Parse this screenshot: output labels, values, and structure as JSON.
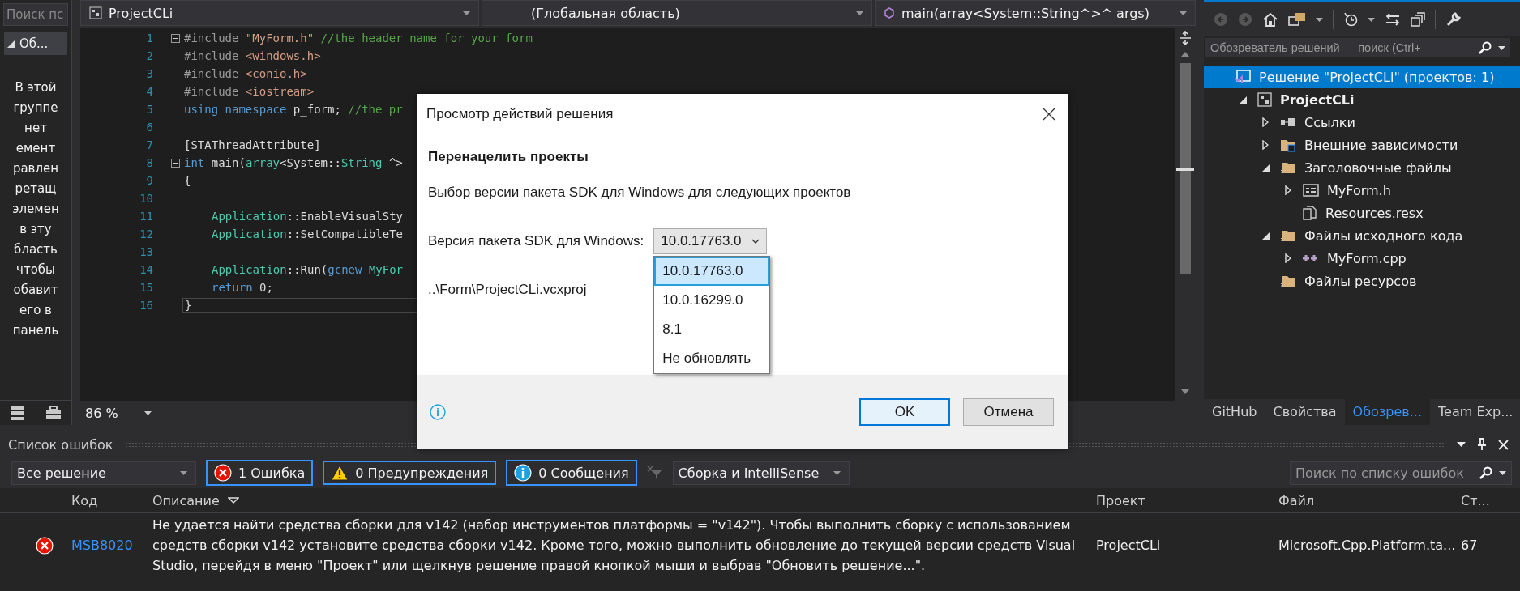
{
  "toolbox": {
    "search": {
      "placeholder": "Поиск пс"
    },
    "group": {
      "label": "Об...",
      "expanded": true
    },
    "message_lines": [
      "В этой",
      "группе",
      "нет",
      "емент",
      "равлен",
      "ретащ",
      "элемен",
      "в эту",
      "бласть",
      "чтобы",
      "обавит",
      "его в",
      "панель"
    ]
  },
  "editor": {
    "nav": [
      {
        "kind": "project",
        "label": "ProjectCLi"
      },
      {
        "kind": "scope",
        "label": "(Глобальная область)"
      },
      {
        "kind": "member",
        "label": "main(array<System::String^>^ args)"
      }
    ],
    "lines": [
      {
        "number": "1",
        "foldable": true,
        "tokens": [
          {
            "t": "#include ",
            "kind": "pre"
          },
          {
            "t": "\"MyForm.h\" ",
            "kind": "str"
          },
          {
            "t": "//the header name for your form",
            "kind": "comment"
          }
        ]
      },
      {
        "number": "2",
        "tokens": [
          {
            "t": "#include ",
            "kind": "pre"
          },
          {
            "t": "<windows.h>",
            "kind": "str"
          }
        ]
      },
      {
        "number": "3",
        "tokens": [
          {
            "t": "#include ",
            "kind": "pre"
          },
          {
            "t": "<conio.h>",
            "kind": "str"
          }
        ]
      },
      {
        "number": "4",
        "tokens": [
          {
            "t": "#include ",
            "kind": "pre"
          },
          {
            "t": "<iostream>",
            "kind": "str"
          }
        ]
      },
      {
        "number": "5",
        "tokens": [
          {
            "t": "using namespace ",
            "kind": "kw"
          },
          {
            "t": "p_form; ",
            "kind": "plain"
          },
          {
            "t": "//the pr",
            "kind": "comment"
          }
        ]
      },
      {
        "number": "6"
      },
      {
        "number": "7",
        "tokens": [
          {
            "t": "[STAThreadAttribute]",
            "kind": "plain"
          }
        ]
      },
      {
        "number": "8",
        "foldable": true,
        "tokens": [
          {
            "t": "int ",
            "kind": "kw"
          },
          {
            "t": "main(",
            "kind": "plain"
          },
          {
            "t": "array",
            "kind": "type"
          },
          {
            "t": "<System::",
            "kind": "plain"
          },
          {
            "t": "String",
            "kind": "type"
          },
          {
            "t": " ^>",
            "kind": "plain"
          }
        ]
      },
      {
        "number": "9",
        "tokens": [
          {
            "t": "{",
            "kind": "plain"
          }
        ]
      },
      {
        "number": "10"
      },
      {
        "number": "11",
        "indented": true,
        "tokens": [
          {
            "t": "Application",
            "kind": "type"
          },
          {
            "t": "::EnableVisualSty",
            "kind": "plain"
          }
        ]
      },
      {
        "number": "12",
        "indented": true,
        "tokens": [
          {
            "t": "Application",
            "kind": "type"
          },
          {
            "t": "::SetCompatibleTe",
            "kind": "plain"
          }
        ]
      },
      {
        "number": "13"
      },
      {
        "number": "14",
        "indented": true,
        "tokens": [
          {
            "t": "Application",
            "kind": "type"
          },
          {
            "t": "::Run(",
            "kind": "plain"
          },
          {
            "t": "gcnew ",
            "kind": "kw"
          },
          {
            "t": "MyFor",
            "kind": "type"
          }
        ]
      },
      {
        "number": "15",
        "indented": true,
        "tokens": [
          {
            "t": "return ",
            "kind": "kw"
          },
          {
            "t": "0;",
            "kind": "plain"
          }
        ]
      },
      {
        "number": "16",
        "current": true,
        "tokens": [
          {
            "t": "}",
            "kind": "plain"
          }
        ]
      }
    ],
    "zoom": "86 %"
  },
  "dialog": {
    "title": "Просмотр действий решения",
    "heading": "Перенацелить проекты",
    "description": "Выбор версии пакета SDK для Windows для следующих проектов",
    "sdk_label": "Версия пакета SDK для Windows:",
    "sdk_value": "10.0.17763.0",
    "sdk_options": [
      {
        "label": "10.0.17763.0",
        "selected": true
      },
      {
        "label": "10.0.16299.0",
        "selected": false
      },
      {
        "label": "8.1",
        "selected": false
      },
      {
        "label": "Не обновлять",
        "selected": false
      }
    ],
    "project_path": "..\\Form\\ProjectCLi.vcxproj",
    "buttons": [
      {
        "kind": "primary",
        "label": "OK"
      },
      {
        "kind": "secondary",
        "label": "Отмена"
      }
    ]
  },
  "solution_explorer": {
    "search": {
      "placeholder": "Обозреватель решений — поиск (Ctrl+"
    },
    "tree": [
      {
        "kind": "solution",
        "label": "Решение \"ProjectCLi\"  (проектов: 1)",
        "selected": true,
        "children": [
          {
            "kind": "project",
            "label": "ProjectCLi",
            "selected": false,
            "expanded": true,
            "children": [
              {
                "kind": "references",
                "label": "Ссылки",
                "selected": false,
                "expanded": false
              },
              {
                "kind": "ext-folder",
                "label": "Внешние зависимости",
                "selected": false,
                "expanded": false
              },
              {
                "kind": "folder",
                "label": "Заголовочные файлы",
                "selected": false,
                "expanded": true,
                "children": [
                  {
                    "kind": "form",
                    "label": "MyForm.h",
                    "selected": false,
                    "expanded": false
                  },
                  {
                    "kind": "file",
                    "label": "Resources.resx",
                    "selected": false
                  }
                ]
              },
              {
                "kind": "folder",
                "label": "Файлы исходного кода",
                "selected": false,
                "expanded": true,
                "children": [
                  {
                    "kind": "cpp",
                    "label": "MyForm.cpp",
                    "selected": false,
                    "expanded": false
                  }
                ]
              },
              {
                "kind": "folder",
                "label": "Файлы ресурсов",
                "selected": false
              }
            ]
          }
        ]
      }
    ],
    "tabs": [
      {
        "label": "GitHub",
        "selected": false
      },
      {
        "label": "Свойства",
        "selected": false
      },
      {
        "label": "Обозрев...",
        "selected": true
      },
      {
        "label": "Team Exp...",
        "selected": false
      }
    ]
  },
  "error_list": {
    "title": "Список ошибок",
    "scope": "Все решение",
    "filters": [
      {
        "kind": "error",
        "label": "1 Ошибка",
        "on": true
      },
      {
        "kind": "warning",
        "label": "0 Предупреждения",
        "on": true
      },
      {
        "kind": "info",
        "label": "0 Сообщения",
        "on": true
      }
    ],
    "source": "Сборка и IntelliSense",
    "search": {
      "placeholder": "Поиск по списку ошибок"
    },
    "columns": [
      "Код",
      "Описание",
      "Проект",
      "Файл",
      "Ст..."
    ],
    "rows": [
      {
        "kind": "error",
        "code": "MSB8020",
        "description": "Не удается найти средства сборки для v142 (набор инструментов платформы = \"v142\"). Чтобы выполнить сборку с использованием средств сборки v142 установите средства сборки v142.  Кроме того, можно выполнить обновление до текущей версии средств Visual Studio, перейдя в меню \"Проект\" или щелкнув решение правой кнопкой мыши и выбрав \"Обновить решение...\".",
        "project": "ProjectCLi",
        "file": "Microsoft.Cpp.Platform.ta...",
        "line": "67"
      }
    ]
  }
}
